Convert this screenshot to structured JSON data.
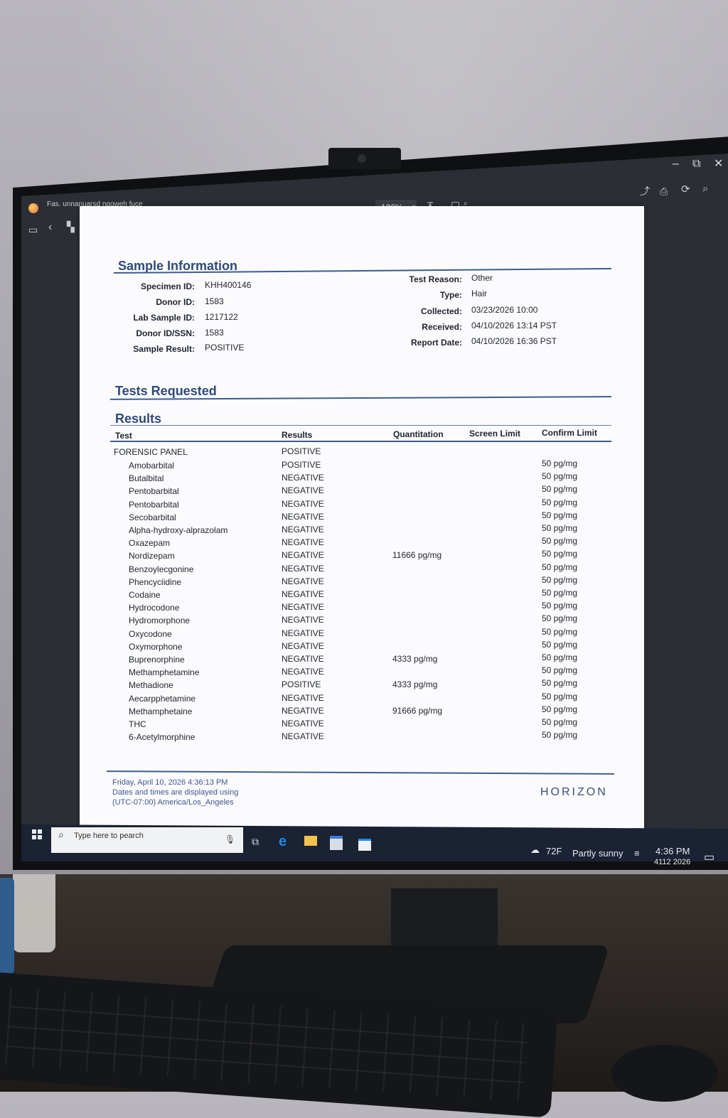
{
  "window": {
    "doc_title": "Fas. unnanuarsd nqoweh fuce",
    "zoom": "120%",
    "controls": {
      "minimize": "–",
      "restore": "⧉",
      "close": "✕"
    }
  },
  "sample_info": {
    "heading": "Sample Information",
    "left": [
      {
        "label": "Specimen ID:",
        "value": "KHH400146"
      },
      {
        "label": "Donor ID:",
        "value": "1583"
      },
      {
        "label": "Lab Sample ID:",
        "value": "1217122"
      },
      {
        "label": "Donor ID/SSN:",
        "value": "1583"
      },
      {
        "label": "Sample Result:",
        "value": "POSITIVE"
      }
    ],
    "right": [
      {
        "label": "Test Reason:",
        "value": "Other"
      },
      {
        "label": "Type:",
        "value": "Hair"
      },
      {
        "label": "Collected:",
        "value": "03/23/2026 10:00"
      },
      {
        "label": "Received:",
        "value": "04/10/2026 13:14 PST"
      },
      {
        "label": "Report Date:",
        "value": "04/10/2026 16:36 PST"
      }
    ]
  },
  "tests_requested": {
    "heading": "Tests Requested"
  },
  "results": {
    "heading": "Results",
    "columns": {
      "test": "Test",
      "results": "Results",
      "quant": "Quantitation",
      "screen": "Screen Limit",
      "confirm": "Confirm Limit"
    },
    "panel": {
      "test": "FORENSIC PANEL",
      "result": "POSITIVE"
    },
    "rows": [
      {
        "test": "Amobarbital",
        "result": "POSITIVE",
        "quant": "",
        "confirm": "50 pg/mg"
      },
      {
        "test": "Butalbital",
        "result": "NEGATIVE",
        "quant": "",
        "confirm": "50 pg/mg"
      },
      {
        "test": "Pentobarbital",
        "result": "NEGATIVE",
        "quant": "",
        "confirm": "50 pg/mg"
      },
      {
        "test": "Pentobarbital",
        "result": "NEGATIVE",
        "quant": "",
        "confirm": "50 pg/mg"
      },
      {
        "test": "Secobarbital",
        "result": "NEGATIVE",
        "quant": "",
        "confirm": "50 pg/mg"
      },
      {
        "test": "Alpha-hydroxy-alprazolam",
        "result": "NEGATIVE",
        "quant": "",
        "confirm": "50 pg/mg"
      },
      {
        "test": "Oxazepam",
        "result": "NEGATIVE",
        "quant": "",
        "confirm": "50 pg/mg"
      },
      {
        "test": "Nordizepam",
        "result": "NEGATIVE",
        "quant": "11666 pg/mg",
        "confirm": "50 pg/mg"
      },
      {
        "test": "Benzoylecgonine",
        "result": "NEGATIVE",
        "quant": "",
        "confirm": "50 pg/mg"
      },
      {
        "test": "Phencyciidine",
        "result": "NEGATIVE",
        "quant": "",
        "confirm": "50 pg/mg"
      },
      {
        "test": "Codaine",
        "result": "NEGATIVE",
        "quant": "",
        "confirm": "50 pg/mg"
      },
      {
        "test": "Hydrocodone",
        "result": "NEGATIVE",
        "quant": "",
        "confirm": "50 pg/mg"
      },
      {
        "test": "Hydromorphone",
        "result": "NEGATIVE",
        "quant": "",
        "confirm": "50 pg/mg"
      },
      {
        "test": "Oxycodone",
        "result": "NEGATIVE",
        "quant": "",
        "confirm": "50 pg/mg"
      },
      {
        "test": "Oxymorphone",
        "result": "NEGATIVE",
        "quant": "",
        "confirm": "50 pg/mg"
      },
      {
        "test": "Buprenorphine",
        "result": "NEGATIVE",
        "quant": "4333 pg/mg",
        "confirm": "50 pg/mg"
      },
      {
        "test": "Methamphetamine",
        "result": "NEGATIVE",
        "quant": "",
        "confirm": "50 pg/mg"
      },
      {
        "test": "Methadione",
        "result": "POSITIVE",
        "quant": "4333 pg/mg",
        "confirm": "50 pg/mg"
      },
      {
        "test": "Aecarpphetamine",
        "result": "NEGATIVE",
        "quant": "",
        "confirm": "50 pg/mg"
      },
      {
        "test": "Methamphetaine",
        "result": "NEGATIVE",
        "quant": "91666 pg/mg",
        "confirm": "50 pg/mg"
      },
      {
        "test": "THC",
        "result": "NEGATIVE",
        "quant": "",
        "confirm": "50 pg/mg"
      },
      {
        "test": "6-Acetylmorphine",
        "result": "NEGATIVE",
        "quant": "",
        "confirm": "50 pg/mg"
      }
    ]
  },
  "footer": {
    "line1": "Friday, April 10, 2026 4:36:13 PM",
    "line2": "Dates and times are displayed using",
    "line3": "(UTC-07:00) America/Los_Angeles",
    "brand": "HORIZON"
  },
  "taskbar": {
    "search_placeholder": "Type here to pearch",
    "temperature": "72F",
    "weather": "Partly sunny",
    "time": "4:36 PM",
    "date": "4112 2026"
  },
  "colors": {
    "heading": "#2f4a7a",
    "rule": "#3e5b8e",
    "taskbar": "#1a2233",
    "edge": "#1e88e5",
    "folder": "#f2c14e"
  }
}
